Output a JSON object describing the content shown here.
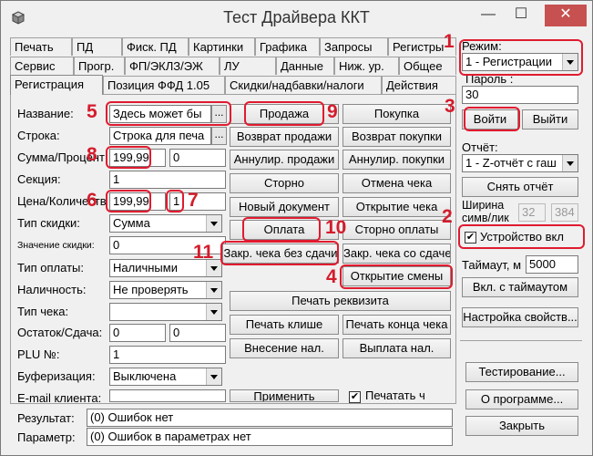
{
  "window": {
    "title": "Тест Драйвера ККТ",
    "minimize_glyph": "—",
    "maximize_glyph": "☐",
    "close_glyph": "✕"
  },
  "tabs": {
    "row1": [
      "Печать",
      "ПД",
      "Фиск. ПД",
      "Картинки",
      "Графика",
      "Запросы",
      "Регистры"
    ],
    "row2": [
      "Сервис",
      "Прогр.",
      "ФП/ЭКЛЗ/ЭЖ",
      "ЛУ",
      "Данные",
      "Ниж. ур.",
      "Общее"
    ],
    "row3": [
      "Регистрация",
      "Позиция ФФД 1.05",
      "Скидки/надбавки/налоги",
      "Действия"
    ]
  },
  "form": {
    "labels": {
      "name": "Название:",
      "line": "Строка:",
      "sum_percent": "Сумма/Процент",
      "section": "Секция:",
      "price_qty": "Цена/Количеств",
      "discount_type": "Тип скидки:",
      "discount_value": "Значение скидки:",
      "payment_type": "Тип оплаты:",
      "cash_check": "Наличность:",
      "check_type": "Тип чека:",
      "balance_change": "Остаток/Сдача:",
      "plu": "PLU №:",
      "buffering": "Буферизация:",
      "email": "E-mail клиента:"
    },
    "values": {
      "name": "Здесь может бы",
      "line": "Строка для печа",
      "sum": "199,99",
      "percent": "0",
      "section": "1",
      "price": "199,99",
      "qty": "1",
      "discount_type": "Сумма",
      "discount_value": "0",
      "payment_type": "Наличными",
      "cash_check": "Не проверять",
      "check_type": "",
      "balance": "0",
      "change": "0",
      "plu": "1",
      "buffering": "Выключена"
    },
    "ellipsis": "..."
  },
  "actions": {
    "sale": "Продажа",
    "purchase": "Покупка",
    "sale_return": "Возврат продажи",
    "purchase_return": "Возврат покупки",
    "sale_cancel": "Аннулир. продажи",
    "purchase_cancel": "Аннулир. покупки",
    "storno": "Сторно",
    "cancel_check": "Отмена чека",
    "new_document": "Новый документ",
    "open_check": "Открытие чека",
    "payment": "Оплата",
    "storno_payment": "Сторно оплаты",
    "close_no_change": "Закр. чека без сдачи",
    "close_with_change": "Закр. чека со сдачей",
    "open_shift": "Открытие смены",
    "print_requisite": "Печать реквизита",
    "print_cliche": "Печать клише",
    "print_end": "Печать конца чека",
    "deposit": "Внесение нал.",
    "withdraw": "Выплата нал.",
    "apply": "Применить",
    "print_check_label": "Печатать ч"
  },
  "right": {
    "mode_label": "Режим:",
    "mode_value": "1 - Регистрации",
    "password_label": "Пароль :",
    "password_value": "30",
    "login": "Войти",
    "logout": "Выйти",
    "report_label": "Отчёт:",
    "report_value": "1 - Z-отчёт с гаш",
    "take_report": "Снять отчёт",
    "width_label": "Ширина симв/лик",
    "width_a": "32",
    "width_b": "384",
    "device_enabled": "Устройство вкл",
    "timeout_label": "Таймаут, м",
    "timeout_value": "5000",
    "enable_timeout": "Вкл. с таймаутом",
    "settings": "Настройка свойств...",
    "testing": "Тестирование...",
    "about": "О программе...",
    "close": "Закрыть"
  },
  "status": {
    "result_label": "Результат:",
    "result_value": "(0) Ошибок нет",
    "param_label": "Параметр:",
    "param_value": "(0) Ошибок в параметрах нет"
  },
  "markers": [
    "1",
    "2",
    "3",
    "4",
    "5",
    "6",
    "7",
    "8",
    "9",
    "10",
    "11"
  ],
  "colors": {
    "annotation_red": "#e01b2f",
    "close_button": "#c75050",
    "window_bg": "#f0f0f0"
  },
  "icons": [
    "app-icon",
    "chevron-down-icon",
    "checkbox-icon"
  ]
}
